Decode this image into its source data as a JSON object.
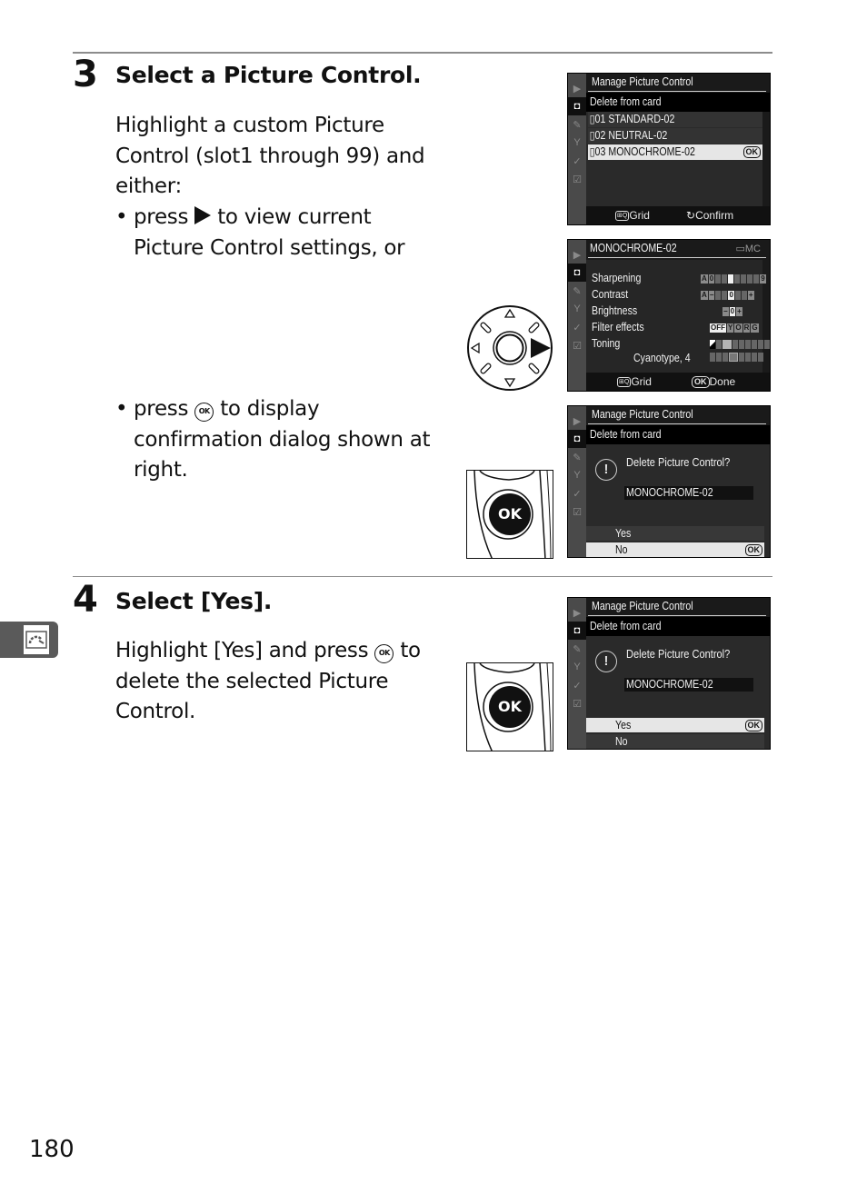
{
  "page_number": "180",
  "side_tab": {
    "icon": "picture-control-icon"
  },
  "step3": {
    "number": "3",
    "title": "Select a Picture Control.",
    "intro_lines": [
      "Highlight a custom Picture",
      "Control (slot1 through 99) and",
      "either:"
    ],
    "bullet1": {
      "pre": "press",
      "glyph": "right-arrow-icon",
      "post_lines": [
        "to view current",
        "Picture Control settings, or"
      ]
    },
    "bullet2": {
      "pre": "press",
      "glyph": "ok-button-icon",
      "glyph_text": "OK",
      "post_lines": [
        "to display",
        "confirmation dialog shown at",
        "right."
      ]
    }
  },
  "step4": {
    "number": "4",
    "title": "Select [Yes].",
    "text_pre": "Highlight [Yes] and press",
    "glyph_text": "OK",
    "text_post": "to",
    "lines": [
      "delete the selected Picture",
      "Control."
    ]
  },
  "hw_ok_label": "OK",
  "screen1": {
    "title": "Manage Picture Control",
    "subtitle": "Delete from card",
    "items": [
      {
        "slot": "01",
        "name": "STANDARD-02",
        "selected": false
      },
      {
        "slot": "02",
        "name": "NEUTRAL-02",
        "selected": false
      },
      {
        "slot": "03",
        "name": "MONOCHROME-02",
        "selected": true
      }
    ],
    "ok_badge": "OK",
    "hint_left": "Grid",
    "hint_right": "Confirm",
    "grid_glyph": "⊞Q"
  },
  "screen2": {
    "title": "MONOCHROME-02",
    "badge": "MC",
    "settings": [
      {
        "label": "Sharpening",
        "value_text": "",
        "min_label": "0",
        "max_label": "9",
        "value": 3
      },
      {
        "label": "Contrast",
        "value_text": "0"
      },
      {
        "label": "Brightness",
        "value_text": "0"
      },
      {
        "label": "Filter effects",
        "options": [
          "OFF",
          "Y",
          "O",
          "R",
          "G"
        ],
        "selected": "OFF"
      },
      {
        "label": "Toning",
        "value_text": "Cyanotype, 4"
      }
    ],
    "toning_value": "Cyanotype, 4",
    "hint_left": "Grid",
    "hint_right": "Done",
    "ok_badge": "OK",
    "auto_label": "A",
    "minus": "−",
    "plus": "+"
  },
  "screen3": {
    "title": "Manage Picture Control",
    "subtitle": "Delete from card",
    "question": "Delete Picture Control?",
    "item_name": "MONOCHROME-02",
    "options": [
      "Yes",
      "No"
    ],
    "selected": "No",
    "ok_badge": "OK",
    "warn_glyph": "!"
  },
  "screen4": {
    "title": "Manage Picture Control",
    "subtitle": "Delete from card",
    "question": "Delete Picture Control?",
    "item_name": "MONOCHROME-02",
    "options": [
      "Yes",
      "No"
    ],
    "selected": "Yes",
    "ok_badge": "OK",
    "warn_glyph": "!"
  }
}
